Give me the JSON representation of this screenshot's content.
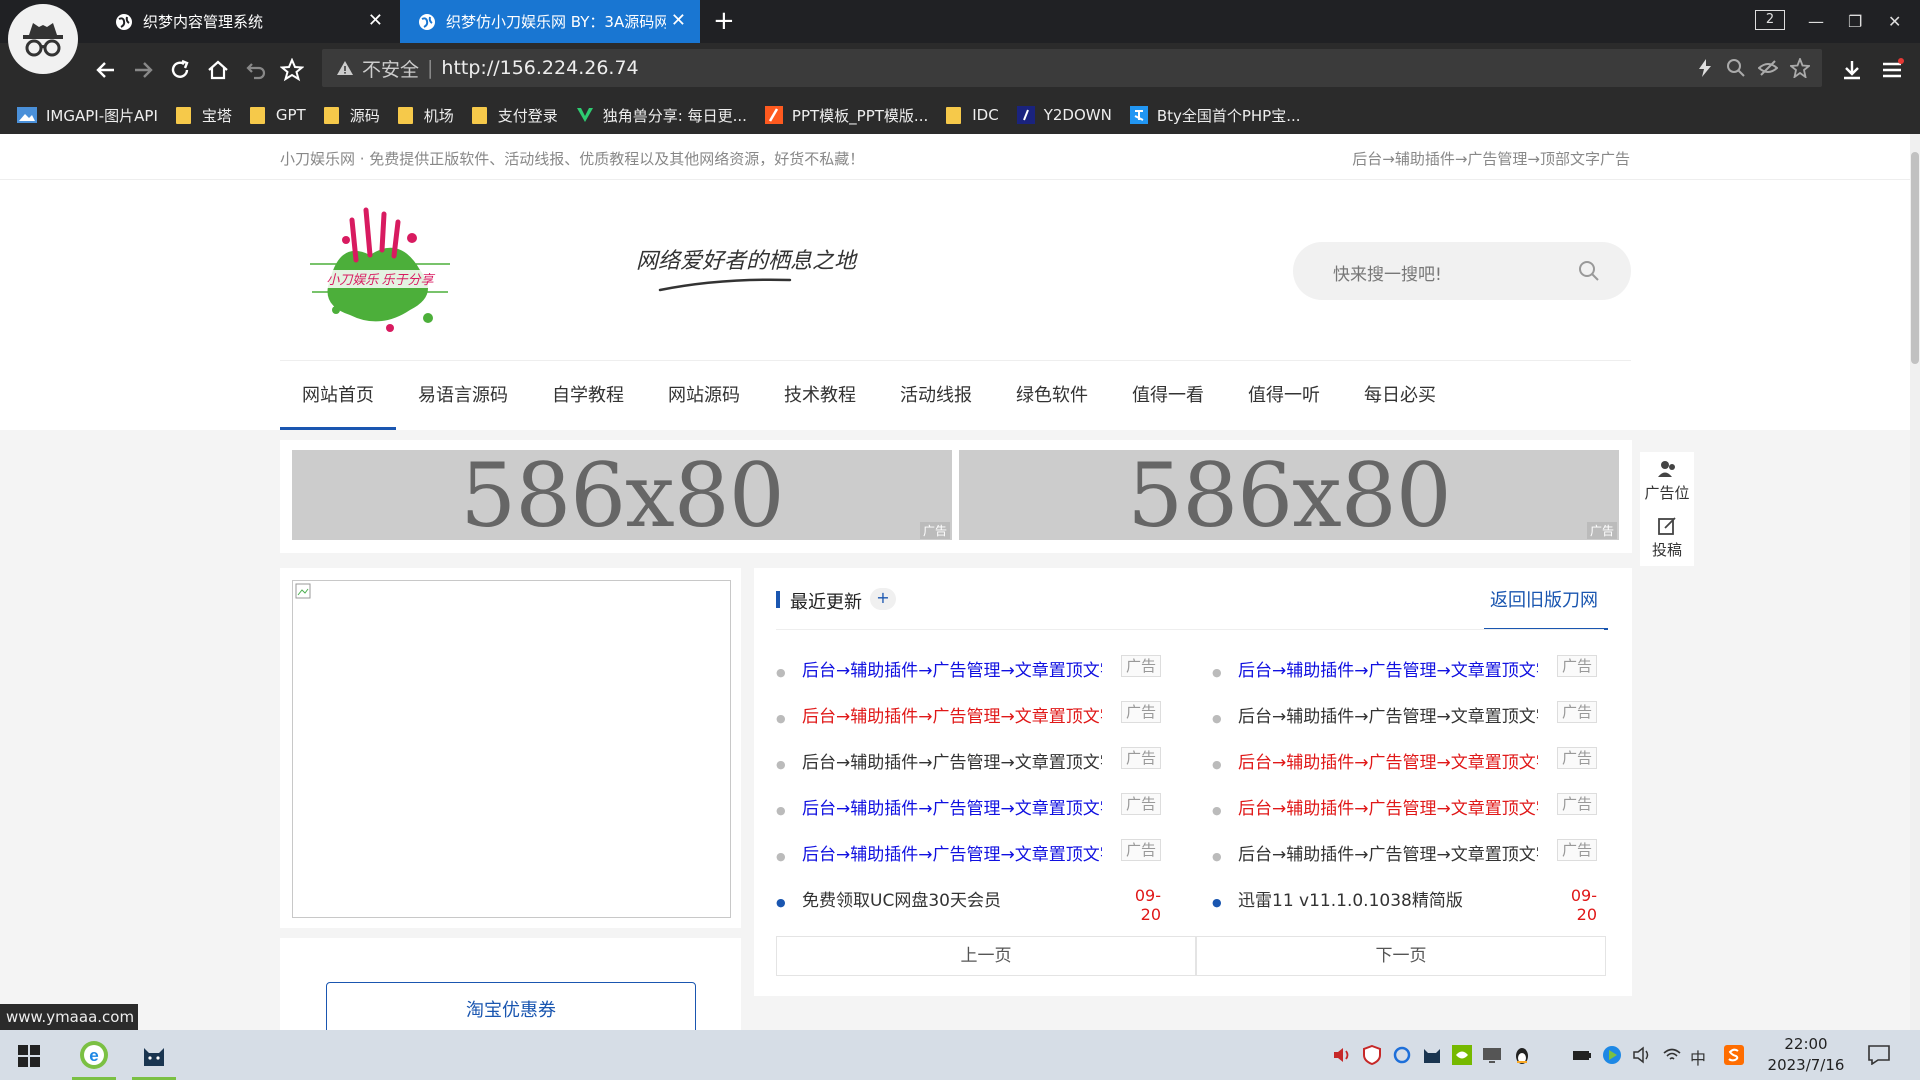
{
  "browser": {
    "tabs": [
      {
        "title": "织梦内容管理系统",
        "active": false
      },
      {
        "title": "织梦仿小刀娱乐网 BY：3A源码网",
        "active": true
      }
    ],
    "tab_count": "2",
    "address": {
      "security_label": "不安全",
      "url": "http://156.224.26.74"
    },
    "bookmarks": [
      {
        "label": "IMGAPI-图片API",
        "icon": "image-icon"
      },
      {
        "label": "宝塔",
        "icon": "folder-icon"
      },
      {
        "label": "GPT",
        "icon": "folder-icon"
      },
      {
        "label": "源码",
        "icon": "folder-icon"
      },
      {
        "label": "机场",
        "icon": "folder-icon"
      },
      {
        "label": "支付登录",
        "icon": "folder-icon"
      },
      {
        "label": "独角兽分享: 每日更...",
        "icon": "v-logo-icon"
      },
      {
        "label": "PPT模板_PPT模版...",
        "icon": "ppt-icon"
      },
      {
        "label": "IDC",
        "icon": "folder-icon"
      },
      {
        "label": "Y2DOWN",
        "icon": "y2-icon"
      },
      {
        "label": "Bty全国首个PHP宝...",
        "icon": "bty-icon"
      }
    ],
    "accent": "#1976d2"
  },
  "site": {
    "topbar": {
      "left": "小刀娱乐网 · 免费提供正版软件、活动线报、优质教程以及其他网络资源，好货不私藏！",
      "right": "后台→辅助插件→广告管理→顶部文字广告"
    },
    "logo_text": "小刀娱乐 乐于分享",
    "slogan": "网络爱好者的栖息之地",
    "search_placeholder": "快来搜一搜吧!",
    "nav": [
      {
        "label": "网站首页",
        "active": true
      },
      {
        "label": "易语言源码",
        "active": false
      },
      {
        "label": "自学教程",
        "active": false
      },
      {
        "label": "网站源码",
        "active": false
      },
      {
        "label": "技术教程",
        "active": false
      },
      {
        "label": "活动线报",
        "active": false
      },
      {
        "label": "绿色软件",
        "active": false
      },
      {
        "label": "值得一看",
        "active": false
      },
      {
        "label": "值得一听",
        "active": false
      },
      {
        "label": "每日必买",
        "active": false
      }
    ],
    "ads": [
      {
        "text": "586x80",
        "tag": "广告"
      },
      {
        "text": "586x80",
        "tag": "广告"
      }
    ],
    "side_float": {
      "ad_label": "广告位",
      "submit_label": "投稿"
    },
    "coupon_button": "淘宝优惠券",
    "recent": {
      "title": "最近更新",
      "plus": "+",
      "old_site": "返回旧版刀网",
      "col1": [
        {
          "text": "后台→辅助插件→广告管理→文章置顶文字广告",
          "color": "blue",
          "badge": "广告"
        },
        {
          "text": "后台→辅助插件→广告管理→文章置顶文字广告",
          "color": "red",
          "badge": "广告"
        },
        {
          "text": "后台→辅助插件→广告管理→文章置顶文字广告",
          "color": "dark",
          "badge": "广告"
        },
        {
          "text": "后台→辅助插件→广告管理→文章置顶文字广告",
          "color": "blue",
          "badge": "广告"
        },
        {
          "text": "后台→辅助插件→广告管理→文章置顶文字广告",
          "color": "blue",
          "badge": "广告"
        },
        {
          "text": "免费领取UC网盘30天会员",
          "color": "dark",
          "date": "09-20"
        }
      ],
      "col2": [
        {
          "text": "后台→辅助插件→广告管理→文章置顶文字广告",
          "color": "blue",
          "badge": "广告"
        },
        {
          "text": "后台→辅助插件→广告管理→文章置顶文字广告",
          "color": "dark",
          "badge": "广告"
        },
        {
          "text": "后台→辅助插件→广告管理→文章置顶文字广告",
          "color": "red",
          "badge": "广告"
        },
        {
          "text": "后台→辅助插件→广告管理→文章置顶文字广告",
          "color": "red",
          "badge": "广告"
        },
        {
          "text": "后台→辅助插件→广告管理→文章置顶文字广告",
          "color": "dark",
          "badge": "广告"
        },
        {
          "text": "迅雷11 v11.1.0.1038精简版",
          "color": "dark",
          "date": "09-20"
        }
      ],
      "prev": "上一页",
      "next": "下一页"
    }
  },
  "status_url": "www.ymaaa.com",
  "taskbar": {
    "time": "22:00",
    "date": "2023/7/16",
    "ime": "中",
    "apps": [
      "ie-browser-icon",
      "cat-app-icon"
    ]
  }
}
